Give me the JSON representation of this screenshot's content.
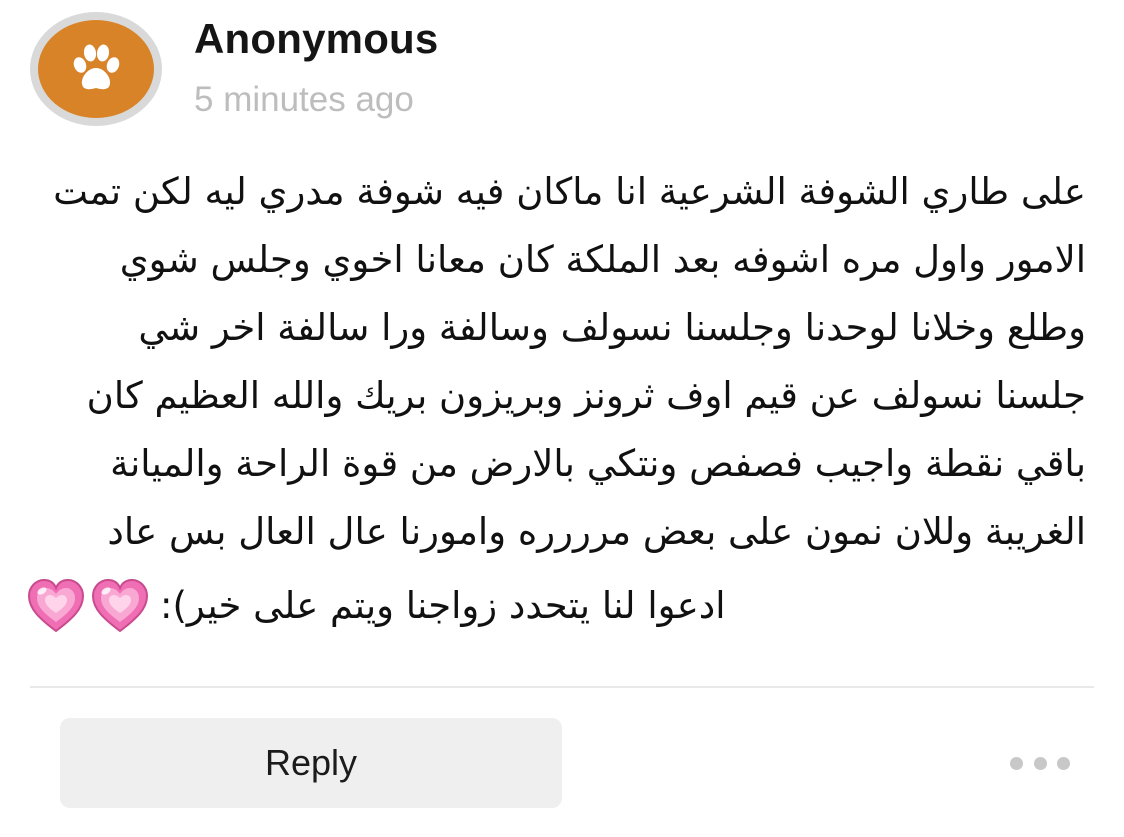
{
  "comment": {
    "author": "Anonymous",
    "timestamp": "5 minutes ago",
    "avatar_icon": "paw-icon",
    "avatar_color": "#d98329",
    "lines": [
      "على طاري الشوفة الشرعية انا ماكان فيه شوفة مدري ليه لكن تمت",
      "الامور واول مره اشوفه بعد الملكة كان معانا اخوي وجلس شوي",
      "وطلع وخلانا لوحدنا وجلسنا نسولف وسالفة ورا سالفة اخر شي",
      "جلسنا نسولف عن قيم اوف ثرونز وبريزون بريك والله العظيم كان",
      "باقي نقطة واجيب فصفص ونتكي بالارض من قوة الراحة والميانة",
      "الغريبة وللان نمون على بعض مرررره وامورنا عال العال بس عاد"
    ],
    "last_line": "ادعوا لنا يتحدد زواجنا ويتم على خير):",
    "emojis": [
      "heart-icon",
      "heart-icon"
    ],
    "emoji_color": "#f06fb4"
  },
  "actions": {
    "reply_label": "Reply",
    "more_icon": "more-dots-icon"
  }
}
